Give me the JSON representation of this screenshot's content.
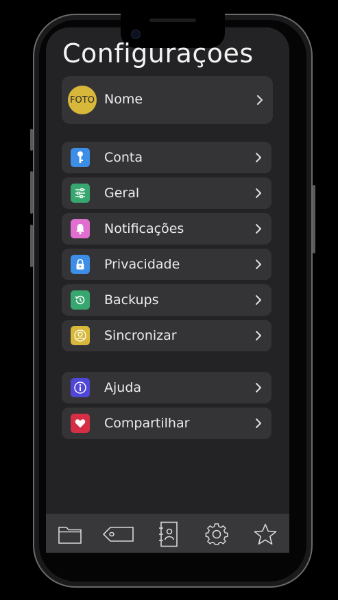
{
  "page": {
    "title": "Configuraçoes"
  },
  "profile": {
    "avatar_text": "FOTO",
    "name": "Nome"
  },
  "menu_group_1": [
    {
      "label": "Conta",
      "icon": "key-icon",
      "color": "#3d8ee6"
    },
    {
      "label": "Geral",
      "icon": "sliders-icon",
      "color": "#37a76f"
    },
    {
      "label": "Notificações",
      "icon": "bell-icon",
      "color": "#e06fd0"
    },
    {
      "label": "Privacidade",
      "icon": "lock-icon",
      "color": "#3d8ee6"
    },
    {
      "label": "Backups",
      "icon": "history-icon",
      "color": "#37a76f"
    },
    {
      "label": "Sincronizar",
      "icon": "user-circle-icon",
      "color": "#d8b83a"
    }
  ],
  "menu_group_2": [
    {
      "label": "Ajuda",
      "icon": "info-icon",
      "color": "#5046d8"
    },
    {
      "label": "Compartilhar",
      "icon": "heart-icon",
      "color": "#d62f45"
    }
  ],
  "tabbar": [
    {
      "icon": "folder-icon"
    },
    {
      "icon": "tag-icon"
    },
    {
      "icon": "contacts-icon"
    },
    {
      "icon": "gear-icon"
    },
    {
      "icon": "star-icon"
    }
  ]
}
